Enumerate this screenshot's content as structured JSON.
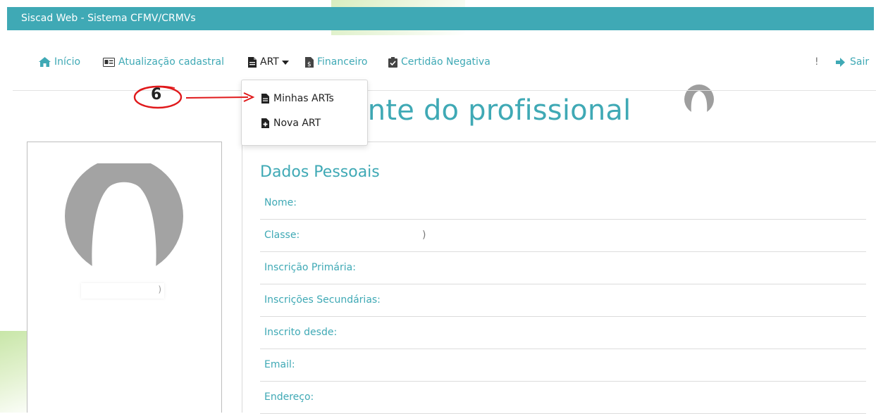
{
  "app": {
    "title": "Siscad Web - Sistema CFMV/CRMVs"
  },
  "nav": {
    "inicio": "Início",
    "atualizacao": "Atualização cadastral",
    "art": "ART",
    "financeiro": "Financeiro",
    "certidao": "Certidão Negativa",
    "exclaim": "!",
    "sair": "Sair"
  },
  "dropdown": {
    "items": [
      {
        "label": "Minhas ARTs",
        "icon": "file-icon"
      },
      {
        "label": "Nova ART",
        "icon": "file-plus-icon"
      }
    ]
  },
  "annotation": {
    "step": "6",
    "color": "#e0191b"
  },
  "page": {
    "heading": "ente do profissional"
  },
  "profile": {
    "name_suffix": ")"
  },
  "details": {
    "section_title": "Dados Pessoais",
    "fields": [
      {
        "label": "Nome:",
        "value": ""
      },
      {
        "label": "Classe:",
        "value": ")"
      },
      {
        "label": "Inscrição Primária:",
        "value": ""
      },
      {
        "label": "Inscrições Secundárias:",
        "value": ""
      },
      {
        "label": "Inscrito desde:",
        "value": ""
      },
      {
        "label": "Email:",
        "value": ""
      },
      {
        "label": "Endereço:",
        "value": ""
      }
    ]
  },
  "colors": {
    "accent": "#3fa9b5",
    "annotation": "#e0191b"
  }
}
